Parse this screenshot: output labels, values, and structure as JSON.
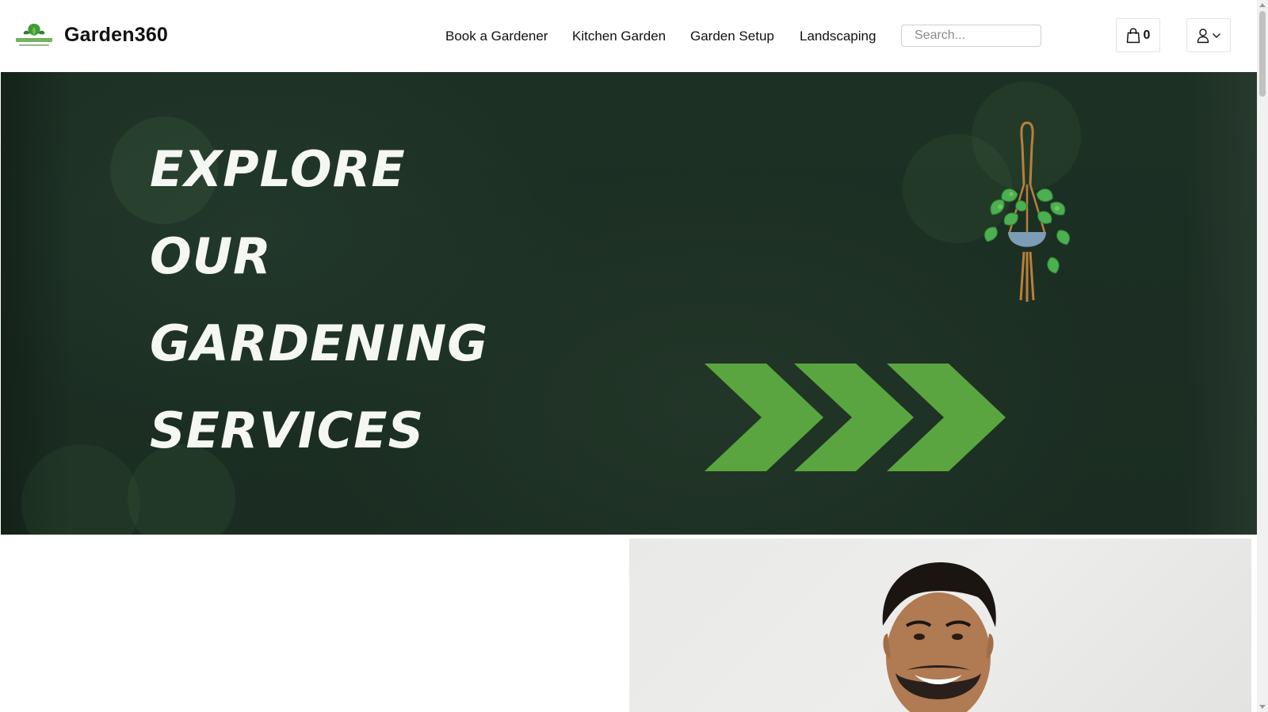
{
  "header": {
    "brand": "Garden360",
    "nav": [
      {
        "label": "Book a Gardener"
      },
      {
        "label": "Kitchen Garden"
      },
      {
        "label": "Garden Setup"
      },
      {
        "label": "Landscaping"
      }
    ],
    "search": {
      "placeholder": "Search...",
      "value": ""
    },
    "cart": {
      "count": "0",
      "icon": "shopping-bag-icon"
    },
    "account": {
      "icon": "user-icon",
      "dropdown_icon": "chevron-down-icon"
    }
  },
  "hero": {
    "lines": [
      "EXPLORE",
      "OUR",
      "GARDENING",
      "SERVICES"
    ]
  },
  "colors": {
    "hero_background": "#1b2d22",
    "arrow_green": "#5aa53f",
    "logo_green": "#3e9a3a"
  }
}
